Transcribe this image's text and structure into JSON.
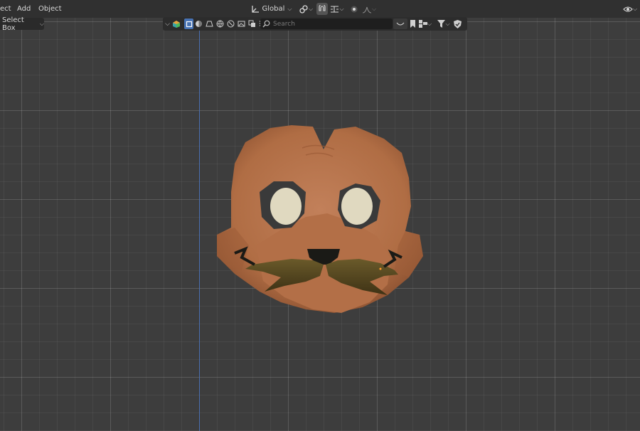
{
  "header": {
    "menu": [
      "ect",
      "Add",
      "Object"
    ],
    "transform_orientation": "Global",
    "icons": [
      "transform-axes-icon",
      "pivot-link-icon",
      "snap-magnet-icon",
      "snap-target-icon",
      "proportional-edit-icon",
      "falloff-curve-icon",
      "visibility-eye-icon"
    ]
  },
  "toolbar": {
    "select_mode": "Select Box",
    "search_placeholder": "Search"
  },
  "colors": {
    "background": "#3d3d3d",
    "header": "#303030",
    "y_axis": "#4a6fb0",
    "mask_skin": "#b8754a",
    "eye": "#e0d9c0",
    "mustache": "#5a4a20"
  }
}
